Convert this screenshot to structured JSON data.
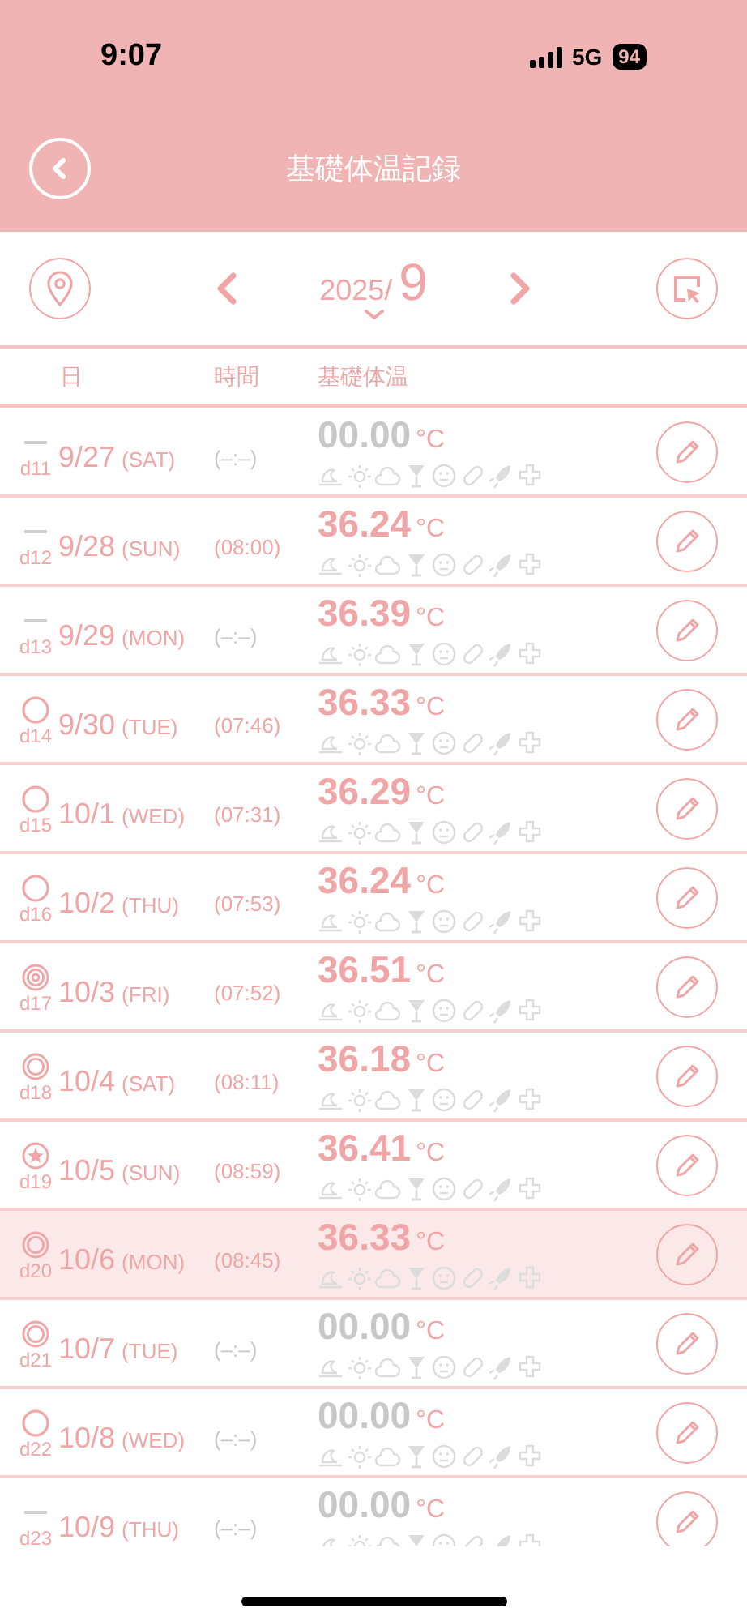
{
  "status_bar": {
    "time": "9:07",
    "network": "5G",
    "battery": "94"
  },
  "header": {
    "title": "基礎体温記録"
  },
  "month_nav": {
    "year": "2025/",
    "month": "9"
  },
  "columns": [
    "日",
    "時間",
    "基礎体温"
  ],
  "rows": [
    {
      "kind": "dash",
      "day": "d11",
      "date": "9/27",
      "weekday": "(SAT)",
      "time": "(–:–)",
      "time_entered": false,
      "temp": "00.00",
      "unit": "°C",
      "temp_entered": false,
      "selected": false
    },
    {
      "kind": "dash",
      "day": "d12",
      "date": "9/28",
      "weekday": "(SUN)",
      "time": "(08:00)",
      "time_entered": true,
      "temp": "36.24",
      "unit": "°C",
      "temp_entered": true,
      "selected": false
    },
    {
      "kind": "dash",
      "day": "d13",
      "date": "9/29",
      "weekday": "(MON)",
      "time": "(–:–)",
      "time_entered": false,
      "temp": "36.39",
      "unit": "°C",
      "temp_entered": true,
      "selected": false
    },
    {
      "kind": "circle",
      "day": "d14",
      "date": "9/30",
      "weekday": "(TUE)",
      "time": "(07:46)",
      "time_entered": true,
      "temp": "36.33",
      "unit": "°C",
      "temp_entered": true,
      "selected": false
    },
    {
      "kind": "circle",
      "day": "d15",
      "date": "10/1",
      "weekday": "(WED)",
      "time": "(07:31)",
      "time_entered": true,
      "temp": "36.29",
      "unit": "°C",
      "temp_entered": true,
      "selected": false
    },
    {
      "kind": "circle",
      "day": "d16",
      "date": "10/2",
      "weekday": "(THU)",
      "time": "(07:53)",
      "time_entered": true,
      "temp": "36.24",
      "unit": "°C",
      "temp_entered": true,
      "selected": false
    },
    {
      "kind": "target",
      "day": "d17",
      "date": "10/3",
      "weekday": "(FRI)",
      "time": "(07:52)",
      "time_entered": true,
      "temp": "36.51",
      "unit": "°C",
      "temp_entered": true,
      "selected": false
    },
    {
      "kind": "double",
      "day": "d18",
      "date": "10/4",
      "weekday": "(SAT)",
      "time": "(08:11)",
      "time_entered": true,
      "temp": "36.18",
      "unit": "°C",
      "temp_entered": true,
      "selected": false
    },
    {
      "kind": "star",
      "day": "d19",
      "date": "10/5",
      "weekday": "(SUN)",
      "time": "(08:59)",
      "time_entered": true,
      "temp": "36.41",
      "unit": "°C",
      "temp_entered": true,
      "selected": false
    },
    {
      "kind": "double",
      "day": "d20",
      "date": "10/6",
      "weekday": "(MON)",
      "time": "(08:45)",
      "time_entered": true,
      "temp": "36.33",
      "unit": "°C",
      "temp_entered": true,
      "selected": true
    },
    {
      "kind": "double",
      "day": "d21",
      "date": "10/7",
      "weekday": "(TUE)",
      "time": "(–:–)",
      "time_entered": false,
      "temp": "00.00",
      "unit": "°C",
      "temp_entered": false,
      "selected": false
    },
    {
      "kind": "circle",
      "day": "d22",
      "date": "10/8",
      "weekday": "(WED)",
      "time": "(–:–)",
      "time_entered": false,
      "temp": "00.00",
      "unit": "°C",
      "temp_entered": false,
      "selected": false
    },
    {
      "kind": "dash",
      "day": "d23",
      "date": "10/9",
      "weekday": "(THU)",
      "time": "(–:–)",
      "time_entered": false,
      "temp": "00.00",
      "unit": "°C",
      "temp_entered": false,
      "selected": false
    }
  ]
}
